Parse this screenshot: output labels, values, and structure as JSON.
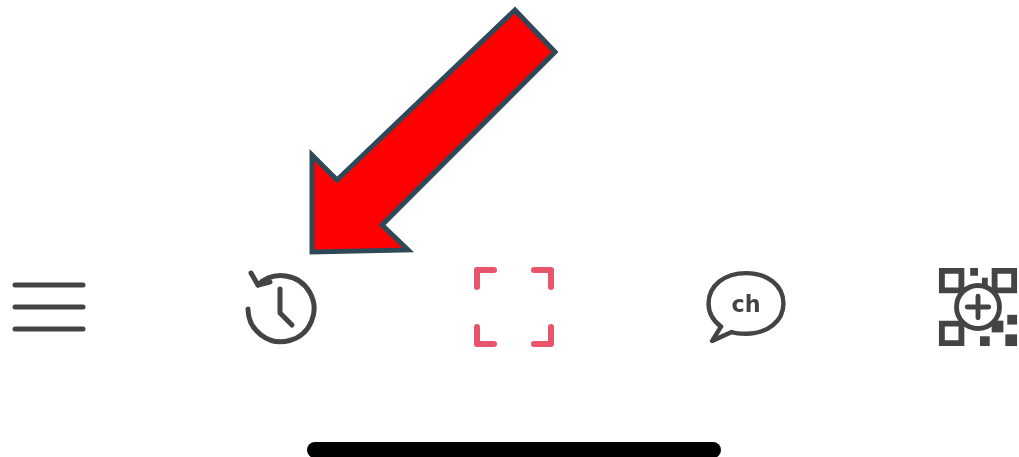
{
  "bottom_nav": [
    {
      "kind": "menu",
      "selected": false
    },
    {
      "kind": "history",
      "selected": false
    },
    {
      "kind": "scan",
      "selected": true
    },
    {
      "kind": "chat",
      "label": "ch",
      "selected": false
    },
    {
      "kind": "qr-add",
      "selected": false
    }
  ]
}
